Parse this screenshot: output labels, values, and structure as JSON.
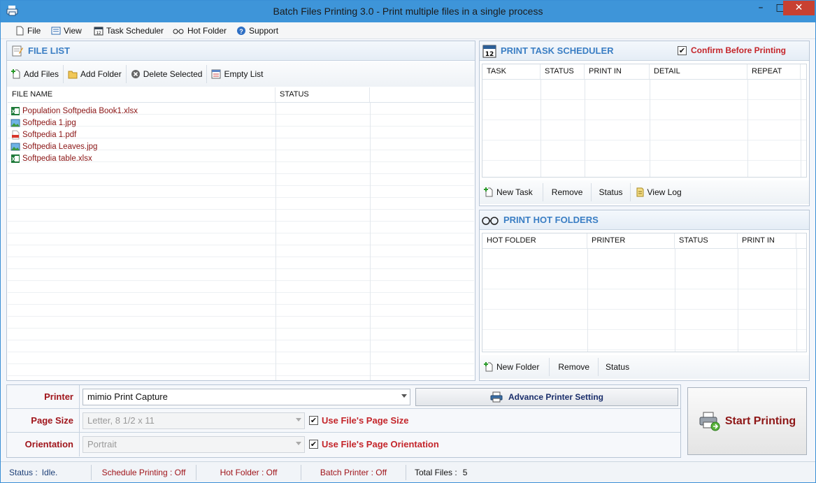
{
  "window": {
    "title": "Batch Files Printing 3.0 - Print multiple files in a single process",
    "minimize": "–",
    "maximize": "□",
    "close": "✕"
  },
  "menu": [
    {
      "label": "File",
      "icon": "file-icon"
    },
    {
      "label": "View",
      "icon": "view-icon"
    },
    {
      "label": "Task Scheduler",
      "icon": "calendar-icon"
    },
    {
      "label": "Hot Folder",
      "icon": "glasses-icon"
    },
    {
      "label": "Support",
      "icon": "help-icon"
    }
  ],
  "file_list": {
    "title": "FILE LIST",
    "toolbar": {
      "add_files": "Add Files",
      "add_folder": "Add Folder",
      "delete_selected": "Delete Selected",
      "empty_list": "Empty List"
    },
    "columns": [
      "FILE NAME",
      "STATUS"
    ],
    "files": [
      {
        "name": "Population Softpedia Book1.xlsx",
        "type": "excel"
      },
      {
        "name": "Softpedia 1.jpg",
        "type": "image"
      },
      {
        "name": "Softpedia 1.pdf",
        "type": "pdf"
      },
      {
        "name": "Softpedia Leaves.jpg",
        "type": "image"
      },
      {
        "name": "Softpedia table.xlsx",
        "type": "excel"
      }
    ]
  },
  "scheduler": {
    "title": "PRINT TASK SCHEDULER",
    "confirm_label": "Confirm Before Printing",
    "confirm_checked": true,
    "columns": [
      "TASK",
      "STATUS",
      "PRINT IN",
      "DETAIL",
      "REPEAT"
    ],
    "toolbar": {
      "new_task": "New Task",
      "remove": "Remove",
      "status": "Status",
      "view_log": "View Log"
    }
  },
  "hot_folders": {
    "title": "PRINT HOT FOLDERS",
    "columns": [
      "HOT FOLDER",
      "PRINTER",
      "STATUS",
      "PRINT IN"
    ],
    "toolbar": {
      "new_folder": "New Folder",
      "remove": "Remove",
      "status": "Status"
    }
  },
  "settings": {
    "printer_label": "Printer",
    "printer_value": "mimio Print Capture",
    "advance_button": "Advance Printer Setting",
    "page_size_label": "Page Size",
    "page_size_value": "Letter, 8 1/2 x 11",
    "use_page_size_label": "Use File's Page Size",
    "use_page_size_checked": true,
    "orientation_label": "Orientation",
    "orientation_value": "Portrait",
    "use_orientation_label": "Use File's Page Orientation",
    "use_orientation_checked": true
  },
  "start_button": "Start Printing",
  "statusbar": {
    "status_label": "Status :",
    "status_value": "Idle.",
    "schedule": "Schedule Printing : Off",
    "hot_folder": "Hot Folder : Off",
    "batch_printer": "Batch Printer : Off",
    "total_files_label": "Total Files :",
    "total_files_value": "5"
  },
  "colors": {
    "titlebar": "#3e95d9",
    "accent_red": "#a0151b",
    "section_blue": "#3a7ec4"
  }
}
